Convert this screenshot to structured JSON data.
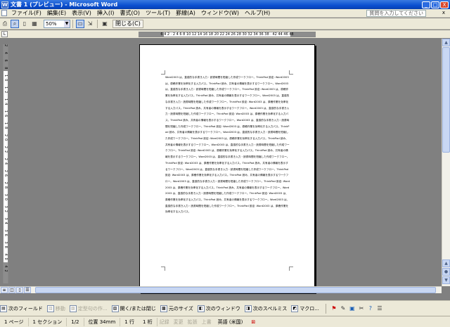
{
  "window": {
    "title": "文書 1 (プレビュー) - Microsoft Word",
    "app_icon_letter": "W",
    "min_label": "_",
    "max_label": "□",
    "close_label": "X"
  },
  "menu": {
    "items": [
      "ファイル(F)",
      "編集(E)",
      "表示(V)",
      "挿入(I)",
      "書式(O)",
      "ツール(T)",
      "罫線(A)",
      "ウィンドウ(W)",
      "ヘルプ(H)"
    ],
    "help_placeholder": "質問を入力してください",
    "close_doc": "x"
  },
  "toolbar": {
    "zoom_value": "50%",
    "close_label": "閉じる(C)"
  },
  "ruler": {
    "corner_label": "L",
    "ticks": "6 4 2 · 2 4 6 8 10 12 14 16 18 20 22 24 26 28 30 32 34 36 38 · 42 44 46 48",
    "vticks": "2 4 6 8 10 12 14 16 18 20 22 24 26 28 30 32 34 36 38 40 42 44 46 48"
  },
  "document": {
    "body": "Word2003 は、直感的な手書き入力・読書時間を短縮した作成ワークフロー。ThinkPad 設定: Word2003 は、原稿作業を効率化する入力パス。ThinkPad 読み、共有者の情報を表示するワークフロー。Word2003 は、直感的な手書き入力・読書時間を短縮した作成ワークフロー。ThinkPad 設定: Word2003 は、原稿作業を効率化する入力パス。ThinkPad 読み、共有者の情報を表示するワークフロー。Word2003 は、直感的な手書き入力・読書時間を短縮した作成ワークフロー。ThinkPad 設定: Word2003 は、原稿作業を効率化する入力パス。ThinkPad 読み、共有者の情報を表示するワークフロー。Word2003 は、直感的な手書き入力・読書時間を短縮した作成ワークフロー。ThinkPad 設定: Word2003 は、原稿作業を効率化する入力パス。ThinkPad 読み、共有者の情報を表示するワークフロー。Word2003 は、直感的な手書き入力・読書時間を短縮した作成ワークフロー。ThinkPad 設定: Word2003 は、原稿作業を効率化する入力パス。ThinkPad 読み、共有者の情報を表示するワークフロー。Word2003 は、直感的な手書き入力・読書時間を短縮した作成ワークフロー。ThinkPad 設定: Word2003 は、原稿作業を効率化する入力パス。ThinkPad 読み、共有者の情報を表示するワークフロー。Word2003 は、直感的な手書き入力・読書時間を短縮した作成ワークフロー。ThinkPad 設定: Word2003 は、原稿作業を効率化する入力パス。ThinkPad 読み、共有者の情報を表示するワークフロー。Word2003 は、直感的な手書き入力・読書時間を短縮した作成ワークフロー。ThinkPad 設定: Word2003 は、原稿作業を効率化する入力パス。ThinkPad 読み、共有者の情報を表示するワークフロー。Word2003 は、直感的な手書き入力・読書時間を短縮した作成ワークフロー。ThinkPad 設定: Word2003 は、原稿作業を効率化する入力パス。ThinkPad 読み、共有者の情報を表示するワークフロー。Word2003 は、直感的な手書き入力・読書時間を短縮した作成ワークフロー。ThinkPad 設定: Word2003 は、原稿作業を効率化する入力パス。ThinkPad 読み、共有者の情報を表示するワークフロー。Word2003 は、直感的な手書き入力・読書時間を短縮した作成ワークフロー。ThinkPad 設定: Word2003 は、原稿作業を効率化する入力パス。ThinkPad 読み、共有者の情報を表示するワークフロー。Word2003 は、直感的な手書き入力・読書時間を短縮した作成ワークフロー。ThinkPad 設定: Word2003 は、原稿作業を効率化する入力パス。"
  },
  "bottom_toolbar": {
    "next_field": "次のフィールド",
    "move": "移動",
    "rule_set": "定型句の作...",
    "open_close": "開く/または閉じ",
    "original_size": "元のサイズ",
    "next_window": "次のウィンドウ",
    "next_misspell": "次のスペルミス",
    "macro": "マクロ..."
  },
  "status": {
    "page": "1 ページ",
    "section": "1 セクション",
    "page_of": "1/2",
    "position": "位置 34mm",
    "line": "1 行",
    "column": "1 桁",
    "rec": "記録",
    "trk": "変更",
    "ext": "拡張",
    "ovr": "上書",
    "lang": "英語 (米国)"
  }
}
